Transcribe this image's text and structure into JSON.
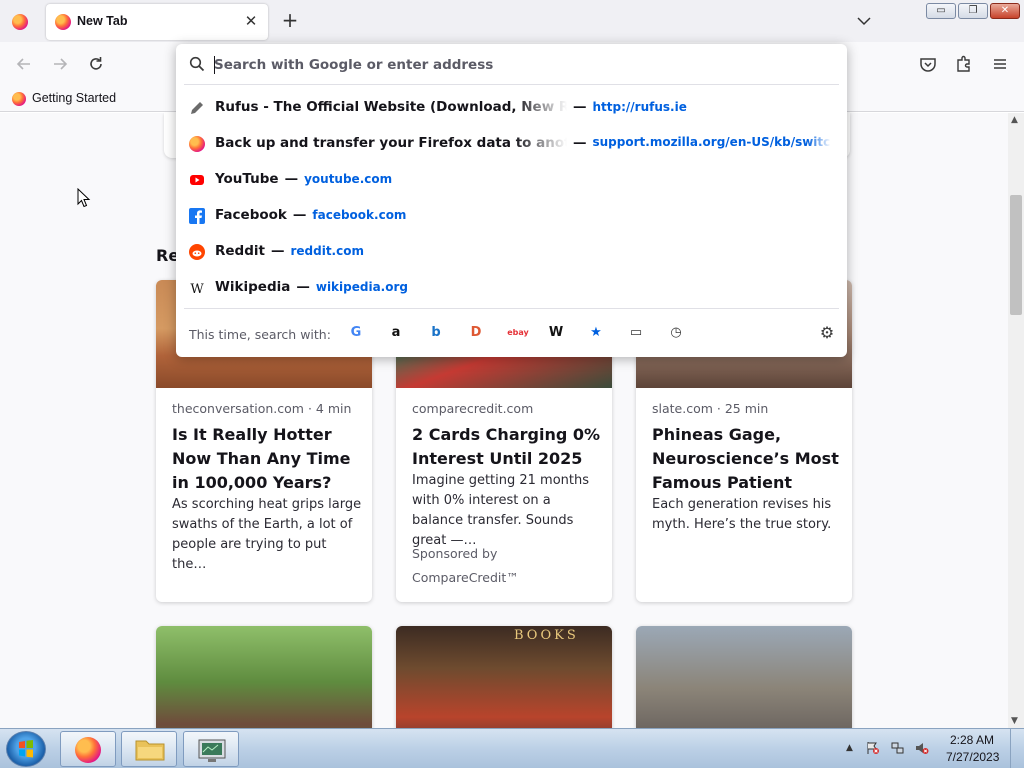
{
  "tabstrip": {
    "tabs": [
      {
        "title": "New Tab",
        "close_glyph": "✕"
      }
    ],
    "new_tab_glyph": "+"
  },
  "window_controls": {
    "minimize": "▭",
    "maximize": "❐",
    "close": "✕"
  },
  "bookmarks": {
    "items": [
      {
        "label": "Getting Started"
      }
    ]
  },
  "urlbar": {
    "placeholder": "Search with Google or enter address",
    "value": "",
    "results": [
      {
        "icon": "pencil-icon",
        "title": "Rufus - The Official Website (Download, New Release",
        "separator": "—",
        "url": "http://rufus.ie"
      },
      {
        "icon": "firefox-icon",
        "title": "Back up and transfer your Firefox data to another de",
        "separator": "—",
        "url": "support.mozilla.org/en-US/kb/switching-d"
      },
      {
        "icon": "youtube-icon",
        "title": "YouTube",
        "separator": "—",
        "url": "youtube.com"
      },
      {
        "icon": "facebook-icon",
        "title": "Facebook",
        "separator": "—",
        "url": "facebook.com"
      },
      {
        "icon": "reddit-icon",
        "title": "Reddit",
        "separator": "—",
        "url": "reddit.com"
      },
      {
        "icon": "wikipedia-icon",
        "title": "Wikipedia",
        "separator": "—",
        "url": "wikipedia.org"
      }
    ],
    "engines_label": "This time, search with:",
    "engines": [
      {
        "name": "google-icon",
        "glyph": "G",
        "color": "#4285f4"
      },
      {
        "name": "amazon-icon",
        "glyph": "a",
        "color": "#111111"
      },
      {
        "name": "bing-icon",
        "glyph": "b",
        "color": "#1a73c8"
      },
      {
        "name": "duckduckgo-icon",
        "glyph": "D",
        "color": "#de5833"
      },
      {
        "name": "ebay-icon",
        "glyph": "ebay",
        "color": "#e53238"
      },
      {
        "name": "wikipedia-icon",
        "glyph": "W",
        "color": "#111111"
      },
      {
        "name": "bookmarks-star-icon",
        "glyph": "★",
        "color": "#0060df"
      },
      {
        "name": "tabs-icon",
        "glyph": "▭",
        "color": "#3a3a3a"
      },
      {
        "name": "history-clock-icon",
        "glyph": "◷",
        "color": "#3a3a3a"
      }
    ]
  },
  "page": {
    "recent_heading": "Rec",
    "cards": [
      {
        "source": "theconversation.com · 4 min",
        "title": "Is It Really Hotter Now Than Any Time in 100,000 Years?",
        "excerpt": "As scorching heat grips large swaths of the Earth, a lot of people are trying to put the…",
        "sponsor": ""
      },
      {
        "source": "comparecredit.com",
        "title": "2 Cards Charging 0% Interest Until 2025",
        "excerpt": "Imagine getting 21 months with 0% interest on a balance transfer. Sounds great —…",
        "sponsor": "Sponsored by CompareCredit™"
      },
      {
        "source": "slate.com · 25 min",
        "title": "Phineas Gage, Neuroscience’s Most Famous Patient",
        "excerpt": "Each generation revises his myth. Here’s the true story.",
        "sponsor": ""
      },
      {
        "source": "",
        "title": "",
        "excerpt": "",
        "sponsor": "",
        "image_text": ""
      },
      {
        "source": "",
        "title": "",
        "excerpt": "",
        "sponsor": "",
        "image_text": "BOOKS"
      },
      {
        "source": "",
        "title": "",
        "excerpt": "",
        "sponsor": "",
        "image_text": ""
      }
    ]
  },
  "taskbar": {
    "clock_time": "2:28 AM",
    "clock_date": "7/27/2023"
  },
  "colors": {
    "accent": "#0060df",
    "tab_strip": "#f0f0f4",
    "toolbar": "#f9f9fb",
    "taskbar": "#bcd0e6"
  }
}
